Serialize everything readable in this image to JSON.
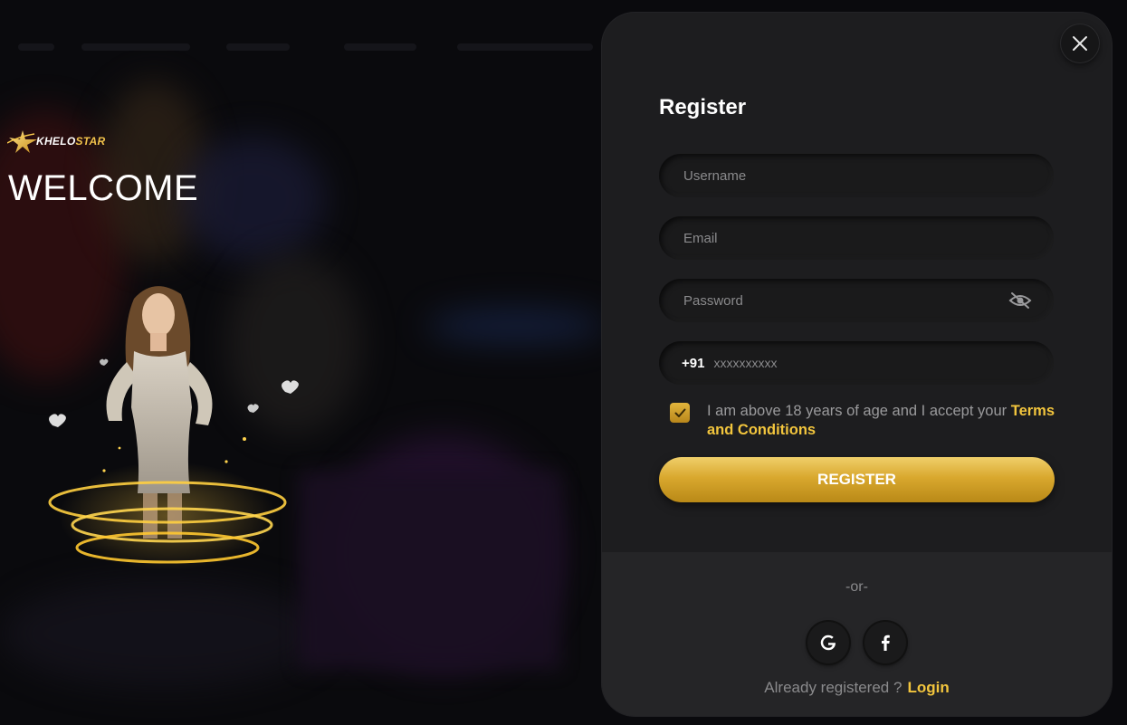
{
  "brand": {
    "logo_prefix": "KHELO",
    "logo_suffix": "STAR",
    "welcome": "WELCOME"
  },
  "modal": {
    "title": "Register",
    "fields": {
      "username_placeholder": "Username",
      "email_placeholder": "Email",
      "password_placeholder": "Password",
      "phone_prefix": "+91",
      "phone_placeholder": "xxxxxxxxxx"
    },
    "consent": {
      "checked": true,
      "text": "I am above 18 years of age and I accept your ",
      "terms_link": "Terms and Conditions"
    },
    "register_label": "REGISTER",
    "or_label": "-or-",
    "social": [
      "google-icon",
      "facebook-icon"
    ],
    "already_text": "Already registered ?",
    "login_label": "Login"
  },
  "icons": {
    "close": "close-icon",
    "password_visibility": "eye-off-icon",
    "checkbox": "check-icon"
  },
  "colors": {
    "accent_gold": "#f2c53d",
    "modal_bg": "#1d1d1f",
    "page_bg": "#0a0a0d"
  }
}
